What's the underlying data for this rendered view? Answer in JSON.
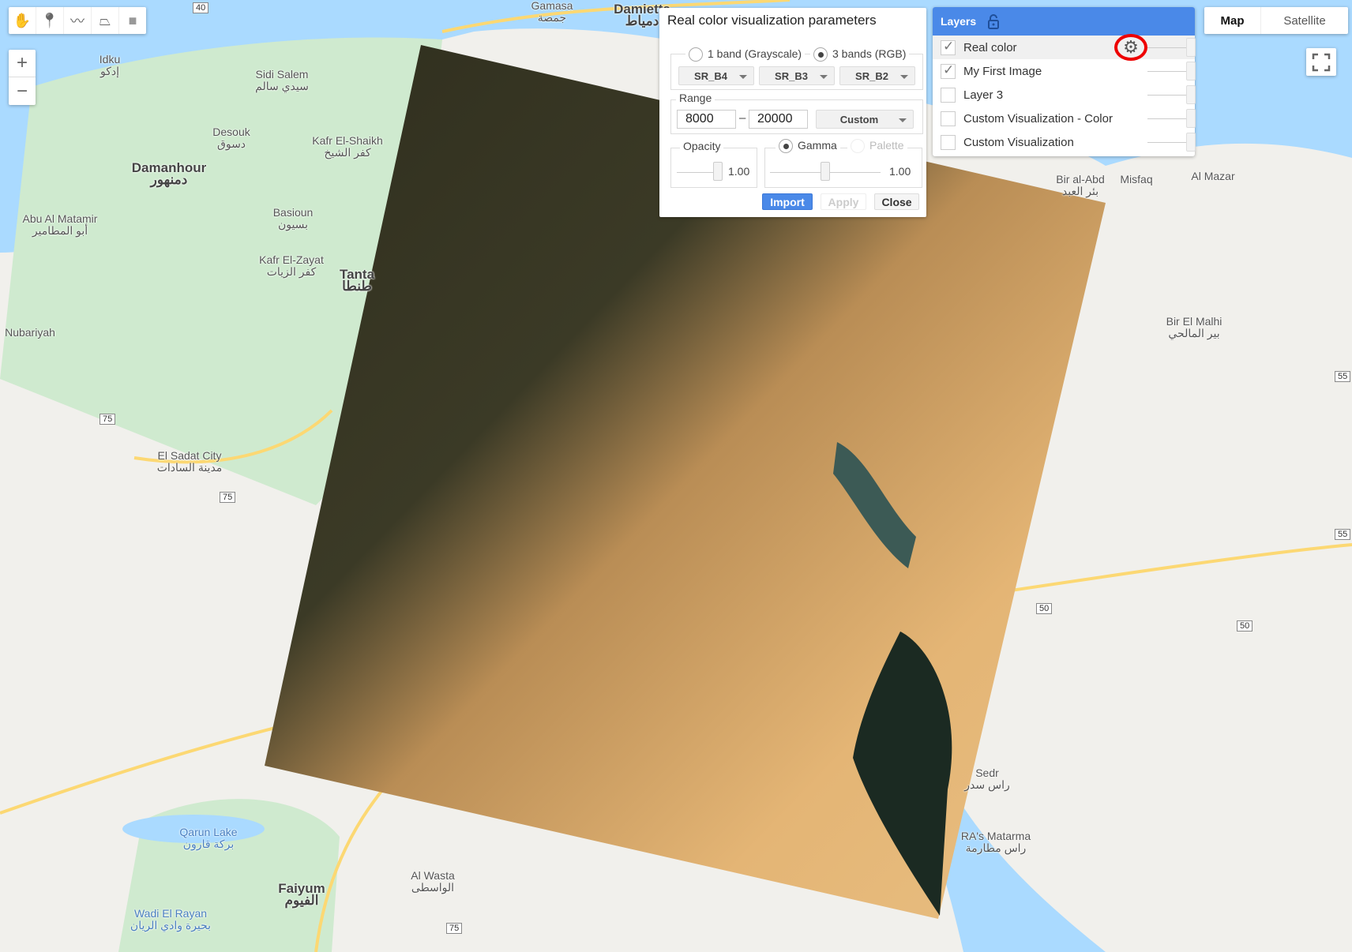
{
  "colors": {
    "water": "#aadaff",
    "land": "#f1f0ec",
    "green": "#cfeacf",
    "road": "#fcd873",
    "accent": "#4a89e8",
    "highlight": "#e00000"
  },
  "toolbar": {
    "tools": [
      {
        "icon": "hand-icon",
        "glyph": "✋"
      },
      {
        "icon": "marker-icon",
        "glyph": "📍"
      },
      {
        "icon": "line-icon",
        "glyph": "〰"
      },
      {
        "icon": "polygon-icon",
        "glyph": "⏢"
      },
      {
        "icon": "rectangle-icon",
        "glyph": "■"
      }
    ]
  },
  "zoom": {
    "in": "+",
    "out": "−"
  },
  "map_labels": [
    {
      "name": "Damanhour",
      "ar": "دمنهور",
      "big": true
    },
    {
      "name": "Desouk",
      "ar": "دسوق"
    },
    {
      "name": "Kafr El-Shaikh",
      "ar": "كفر الشيخ"
    },
    {
      "name": "Sidi Salem",
      "ar": "سيدي سالم"
    },
    {
      "name": "Idku",
      "ar": "إدكو"
    },
    {
      "name": "Basioun",
      "ar": "بسيون"
    },
    {
      "name": "Kafr El-Zayat",
      "ar": "كفر الزيات"
    },
    {
      "name": "Abu Al Matamir",
      "ar": "أبو المطامير"
    },
    {
      "name": "El Sadat City",
      "ar": "مدينة السادات"
    },
    {
      "name": "Faiyum",
      "ar": "الفيوم",
      "big": true
    },
    {
      "name": "Qarun Lake",
      "ar": "بركة قارون",
      "water": true
    },
    {
      "name": "Wadi El Rayan",
      "ar": "بحيرة وادي الريان",
      "water": true
    },
    {
      "name": "Al Wasta",
      "ar": "الواسطى"
    },
    {
      "name": "Bir al-Abd",
      "ar": "بئر العبد"
    },
    {
      "name": "Misfaq",
      "ar": ""
    },
    {
      "name": "Al Mazar",
      "ar": ""
    },
    {
      "name": "Bir El Malhi",
      "ar": "بير المالحي"
    },
    {
      "name": "Sedr",
      "ar": "راس سدر"
    },
    {
      "name": "RA's Matarma",
      "ar": "راس مطارمة"
    },
    {
      "name": "Damietta",
      "ar": "دمياط",
      "big": true
    },
    {
      "name": "Tanta",
      "ar": "طنطا",
      "big": true
    },
    {
      "name": "Nubariyah",
      "ar": ""
    },
    {
      "name": "Gamasa",
      "ar": "جمصة"
    }
  ],
  "road_shields": [
    "40",
    "75",
    "75",
    "50",
    "50",
    "55",
    "55",
    "75"
  ],
  "viz": {
    "title": "Real color visualization parameters",
    "mode_gray": "1 band (Grayscale)",
    "mode_rgb": "3 bands (RGB)",
    "mode_selected": "rgb",
    "bands": [
      "SR_B4",
      "SR_B3",
      "SR_B2"
    ],
    "range_label": "Range",
    "range_min": "8000",
    "range_sep": "–",
    "range_max": "20000",
    "range_mode": "Custom",
    "opacity_label": "Opacity",
    "opacity_value": "1.00",
    "opacity": 1.0,
    "gamma_label": "Gamma",
    "palette_label": "Palette",
    "gamma_value": "1.00",
    "gamma": 1.0,
    "import": "Import",
    "apply": "Apply",
    "close": "Close"
  },
  "layers": {
    "title": "Layers",
    "items": [
      {
        "label": "Real color",
        "checked": true,
        "settings": true
      },
      {
        "label": "My First Image",
        "checked": true
      },
      {
        "label": "Layer 3",
        "checked": false
      },
      {
        "label": "Custom Visualization - Color",
        "checked": false
      },
      {
        "label": "Custom Visualization",
        "checked": false
      }
    ]
  },
  "map_type": {
    "map": "Map",
    "satellite": "Satellite",
    "selected": "Map"
  }
}
